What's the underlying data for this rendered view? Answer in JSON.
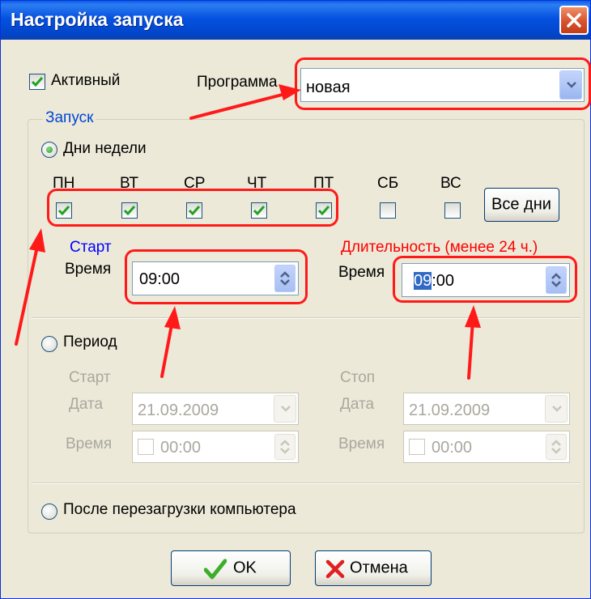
{
  "window": {
    "title": "Настройка запуска"
  },
  "active": {
    "label": "Активный",
    "checked": true
  },
  "program": {
    "label": "Программа",
    "value": "новая"
  },
  "launch_group": {
    "title": "Запуск"
  },
  "weekdays_option": {
    "label": "Дни недели",
    "selected": true
  },
  "days": [
    {
      "label": "ПН",
      "checked": true
    },
    {
      "label": "ВТ",
      "checked": true
    },
    {
      "label": "СР",
      "checked": true
    },
    {
      "label": "ЧТ",
      "checked": true
    },
    {
      "label": "ПТ",
      "checked": true
    },
    {
      "label": "СБ",
      "checked": false
    },
    {
      "label": "ВС",
      "checked": false
    }
  ],
  "all_days_button": {
    "label": "Все дни"
  },
  "start": {
    "heading": "Старт",
    "time_label": "Время",
    "time_value": "09:00"
  },
  "duration": {
    "heading": "Длительность (менее 24 ч.)",
    "time_label": "Время",
    "time_selected": "09",
    "time_rest": ":00"
  },
  "period_option": {
    "label": "Период",
    "selected": false
  },
  "period_start": {
    "heading": "Старт",
    "date_label": "Дата",
    "date_value": "21.09.2009",
    "time_label": "Время",
    "time_value": "00:00"
  },
  "period_stop": {
    "heading": "Стоп",
    "date_label": "Дата",
    "date_value": "21.09.2009",
    "time_label": "Время",
    "time_value": "00:00"
  },
  "reboot_option": {
    "label": "После перезагрузки компьютера",
    "selected": false
  },
  "ok_button": {
    "label": "OK"
  },
  "cancel_button": {
    "label": "Отмена"
  },
  "colors": {
    "title_bar": "#0551e0",
    "dialog_bg": "#ece9d8",
    "group_title": "#0046d5",
    "highlight": "#ff1a1a"
  },
  "icons": [
    "close-icon",
    "checkmark-icon",
    "chevron-down-icon",
    "spin-arrows-icon",
    "ok-check-icon",
    "cancel-x-icon"
  ]
}
